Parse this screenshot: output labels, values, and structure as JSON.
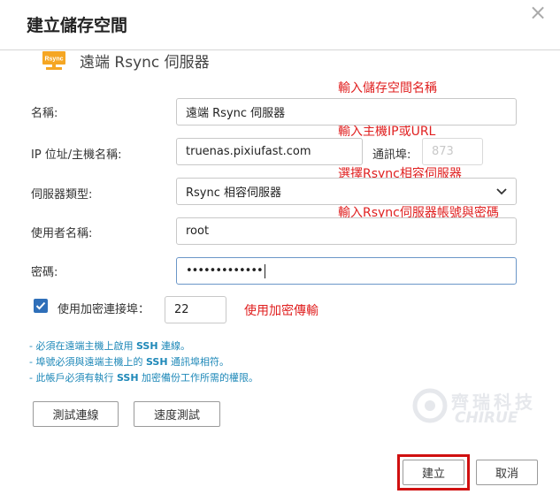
{
  "dialog": {
    "title": "建立儲存空間",
    "close_icon": "close-icon",
    "subtitle": "遠端 Rsync 伺服器",
    "logo_text": "Rsync"
  },
  "form": {
    "name_label": "名稱:",
    "name_value": "遠端 Rsync 伺服器",
    "ip_label": "IP 位址/主機名稱:",
    "ip_value": "truenas.pixiufast.com",
    "port_label": "通訊埠:",
    "port_value": "873",
    "server_type_label": "伺服器類型:",
    "server_type_value": "Rsync 相容伺服器",
    "username_label": "使用者名稱:",
    "username_value": "root",
    "password_label": "密碼:",
    "password_value": "•••••••••••••",
    "encrypt_checked": true,
    "encrypt_label": "使用加密連接埠：",
    "encrypt_port_value": "22"
  },
  "annotations": {
    "name": "輸入儲存空間名稱",
    "ip": "輸入主機IP或URL",
    "server": "選擇Rsync相容伺服器",
    "account": "輸入Rsync伺服器帳號與密碼",
    "encrypt": "使用加密傳輸"
  },
  "notes": [
    {
      "pre": "- 必須在遠端主機上啟用 ",
      "bold": "SSH",
      "post": " 連線。"
    },
    {
      "pre": "- 埠號必須與遠端主機上的 ",
      "bold": "SSH",
      "post": " 通訊埠相符。"
    },
    {
      "pre": "- 此帳戶必須有執行 ",
      "bold": "SSH",
      "post": " 加密備份工作所需的權限。"
    }
  ],
  "buttons": {
    "test_connection": "測試連線",
    "speed_test": "速度測試",
    "create": "建立",
    "cancel": "取消"
  },
  "watermark": {
    "cn": "齊瑞科技",
    "en": "CHIRUE"
  },
  "colors": {
    "annotation": "#e02020",
    "accent": "#2f6fb9",
    "note": "#1e88b8",
    "highlight": "#d01010"
  }
}
